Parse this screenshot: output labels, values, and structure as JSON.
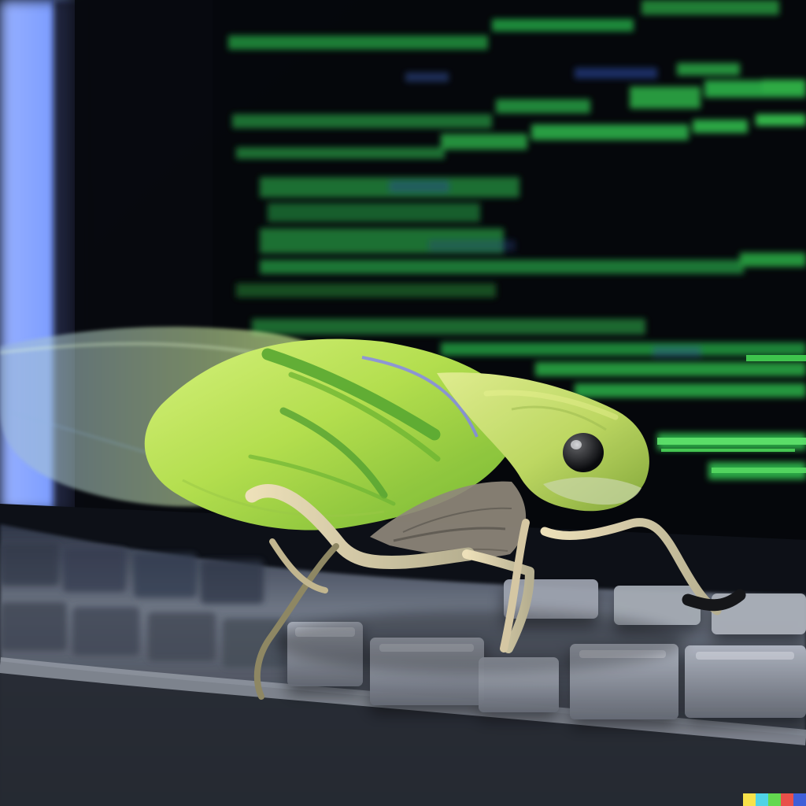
{
  "scene": {
    "subject_icon": "cicada-icon",
    "background_icon": "terminal-screen-icon",
    "foreground_icon": "keyboard-icon"
  },
  "colors": {
    "background": "#06080b",
    "screen_blue": "#7f9fff",
    "terminal_green": "#31c447",
    "terminal_bright_green": "#67e86b",
    "insect_lime": "#bde44d",
    "insect_dark_lime": "#6ca91e",
    "keyboard_gray": "#8b9099",
    "keyboard_shadow": "#202328",
    "strip_yellow": "#f7e24a",
    "strip_cyan": "#4fd3e6",
    "strip_green": "#63d84f",
    "strip_red": "#e9504a",
    "strip_blue": "#3f5fd8"
  }
}
